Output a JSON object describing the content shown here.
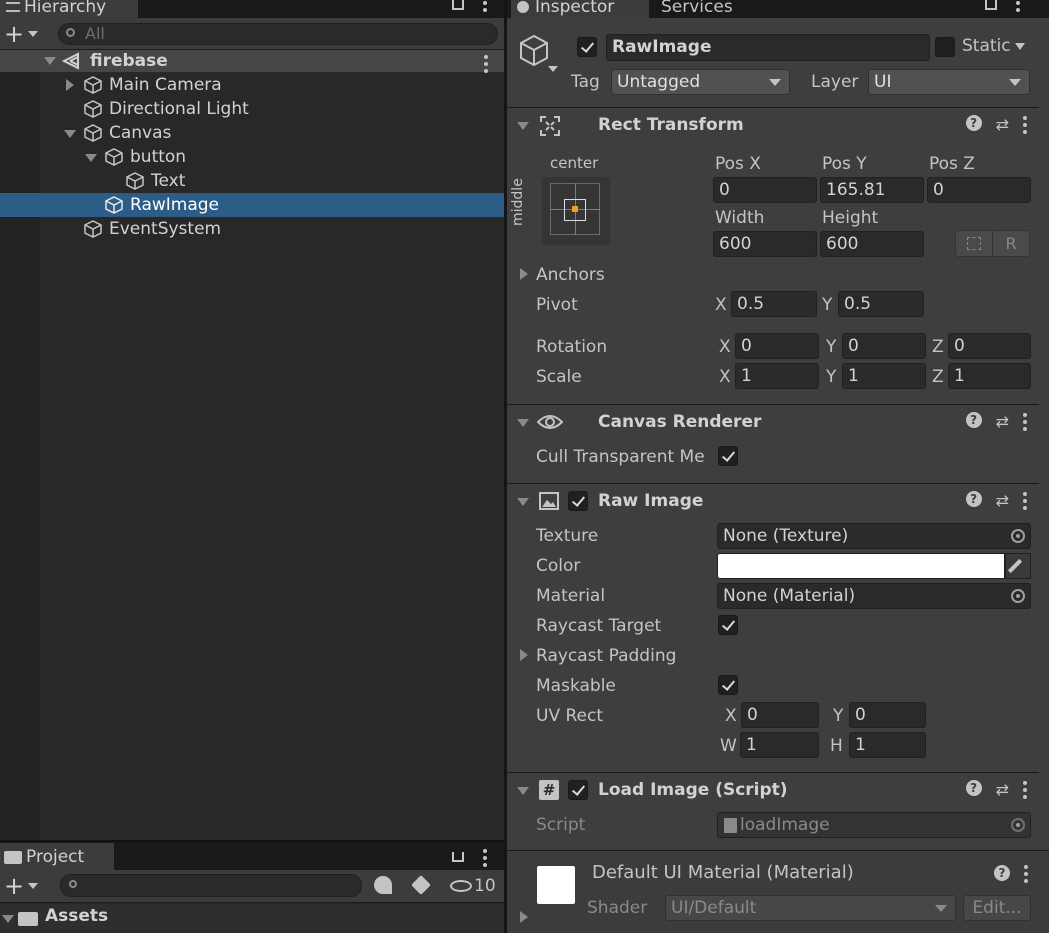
{
  "hierarchy": {
    "tab_label": "Hierarchy",
    "search_placeholder": "All",
    "scene_name": "firebase",
    "items": [
      {
        "label": "Main Camera"
      },
      {
        "label": "Directional Light"
      },
      {
        "label": "Canvas"
      },
      {
        "label": "button"
      },
      {
        "label": "Text"
      },
      {
        "label": "RawImage"
      },
      {
        "label": "EventSystem"
      }
    ]
  },
  "project": {
    "tab_label": "Project",
    "hidden_count": "10",
    "assets_label": "Assets"
  },
  "inspector": {
    "tab_label": "Inspector",
    "services_tab_label": "Services",
    "object_name": "RawImage",
    "static_label": "Static",
    "tag_label": "Tag",
    "tag_value": "Untagged",
    "layer_label": "Layer",
    "layer_value": "UI"
  },
  "rect_transform": {
    "title": "Rect Transform",
    "anchor_h": "center",
    "anchor_v": "middle",
    "pos_x_label": "Pos X",
    "pos_x": "0",
    "pos_y_label": "Pos Y",
    "pos_y": "165.81",
    "pos_z_label": "Pos Z",
    "pos_z": "0",
    "width_label": "Width",
    "width": "600",
    "height_label": "Height",
    "height": "600",
    "anchors_label": "Anchors",
    "pivot_label": "Pivot",
    "pivot_x": "0.5",
    "pivot_y": "0.5",
    "rotation_label": "Rotation",
    "rot_x": "0",
    "rot_y": "0",
    "rot_z": "0",
    "scale_label": "Scale",
    "scale_x": "1",
    "scale_y": "1",
    "scale_z": "1",
    "x": "X",
    "y": "Y",
    "z": "Z",
    "r_button": "R"
  },
  "canvas_renderer": {
    "title": "Canvas Renderer",
    "cull_label": "Cull Transparent Me"
  },
  "raw_image": {
    "title": "Raw Image",
    "texture_label": "Texture",
    "texture_value": "None (Texture)",
    "color_label": "Color",
    "color_value": "#ffffff",
    "material_label": "Material",
    "material_value": "None (Material)",
    "raycast_target_label": "Raycast Target",
    "raycast_padding_label": "Raycast Padding",
    "maskable_label": "Maskable",
    "uv_rect_label": "UV Rect",
    "uv_x": "0",
    "uv_y": "0",
    "uv_w": "1",
    "uv_h": "1",
    "x": "X",
    "y": "Y",
    "w": "W",
    "h": "H"
  },
  "load_image": {
    "title": "Load Image (Script)",
    "script_label": "Script",
    "script_value": "loadImage"
  },
  "material": {
    "name": "Default UI Material (Material)",
    "shader_label": "Shader",
    "shader_value": "UI/Default",
    "edit_label": "Edit..."
  }
}
